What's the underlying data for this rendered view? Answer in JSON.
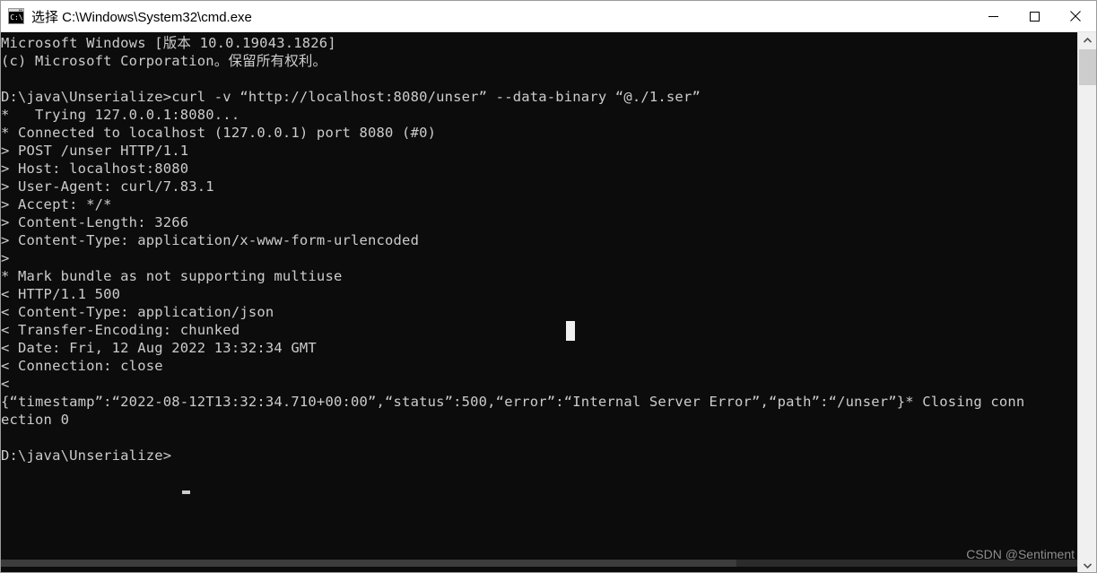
{
  "window": {
    "title": "选择 C:\\Windows\\System32\\cmd.exe",
    "icon": "cmd-console-icon",
    "background_color": "#0c0c0c",
    "titlebar_color": "#ffffff",
    "text_color": "#cccccc",
    "controls": {
      "minimize_label": "—",
      "maximize_label": "□",
      "close_label": "✕"
    }
  },
  "terminal": {
    "lines": [
      "Microsoft Windows [版本 10.0.19043.1826]",
      "(c) Microsoft Corporation。保留所有权利。",
      "",
      "D:\\java\\Unserialize>curl -v “http://localhost:8080/unser” --data-binary “@./1.ser”",
      "*   Trying 127.0.0.1:8080...",
      "* Connected to localhost (127.0.0.1) port 8080 (#0)",
      "> POST /unser HTTP/1.1",
      "> Host: localhost:8080",
      "> User-Agent: curl/7.83.1",
      "> Accept: */*",
      "> Content-Length: 3266",
      "> Content-Type: application/x-www-form-urlencoded",
      ">",
      "* Mark bundle as not supporting multiuse",
      "< HTTP/1.1 500",
      "< Content-Type: application/json",
      "< Transfer-Encoding: chunked",
      "< Date: Fri, 12 Aug 2022 13:32:34 GMT",
      "< Connection: close",
      "<",
      "{“timestamp”:“2022-08-12T13:32:34.710+00:00”,“status”:500,“error”:“Internal Server Error”,“path”:“/unser”}* Closing conn",
      "ection 0",
      "",
      "D:\\java\\Unserialize>"
    ],
    "prompt": "D:\\java\\Unserialize>",
    "cursor": "block-caret",
    "hover_cursor": "text-selection-block"
  },
  "scrollbars": {
    "vertical": {
      "up_arrow": "⌃",
      "down_arrow": "⌄"
    }
  },
  "watermark": {
    "text": "CSDN @Sentiment"
  }
}
